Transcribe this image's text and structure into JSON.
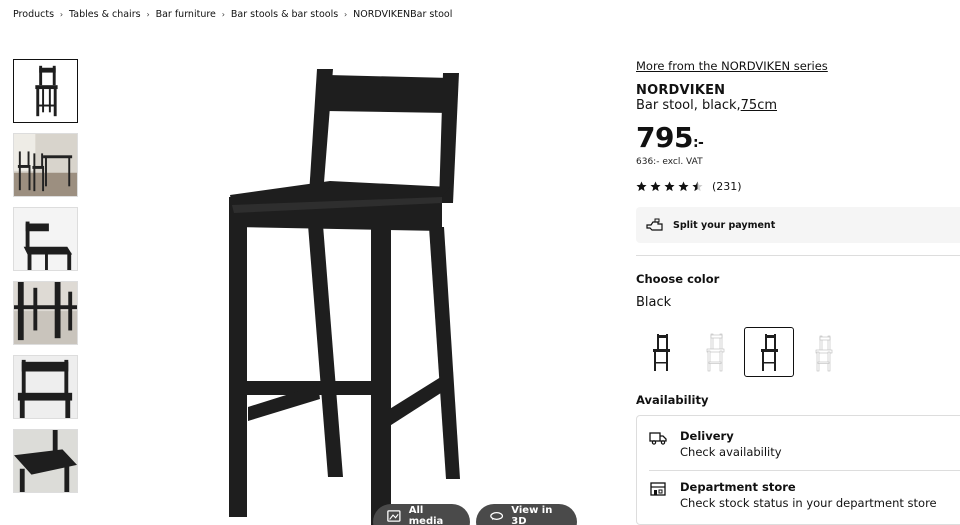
{
  "breadcrumb": [
    "Products",
    "Tables & chairs",
    "Bar furniture",
    "Bar stools & bar stools",
    "NORDVIKENBar stool"
  ],
  "product": {
    "series_link": "More from the NORDVIKEN series",
    "name": "NORDVIKEN",
    "description_prefix": "Bar stool, black,",
    "description_size": "75cm",
    "price": "795",
    "price_suffix": ":-",
    "price_excl_vat": "636:- excl. VAT",
    "rating_stars": 4.5,
    "rating_count": "(231)"
  },
  "payment": {
    "label": "Split your payment"
  },
  "color": {
    "heading": "Choose color",
    "selected": "Black",
    "options": [
      "black-75",
      "white-75",
      "black-75-selected",
      "white-62"
    ]
  },
  "availability": {
    "heading": "Availability",
    "delivery_title": "Delivery",
    "delivery_sub": "Check availability",
    "store_title": "Department store",
    "store_sub": "Check stock status in your department store"
  },
  "media": {
    "all_media": "All media",
    "view_3d": "View in 3D"
  },
  "colors": {
    "stool": "#1e1e1e",
    "accent": "#111111",
    "panel": "#f5f5f5"
  }
}
